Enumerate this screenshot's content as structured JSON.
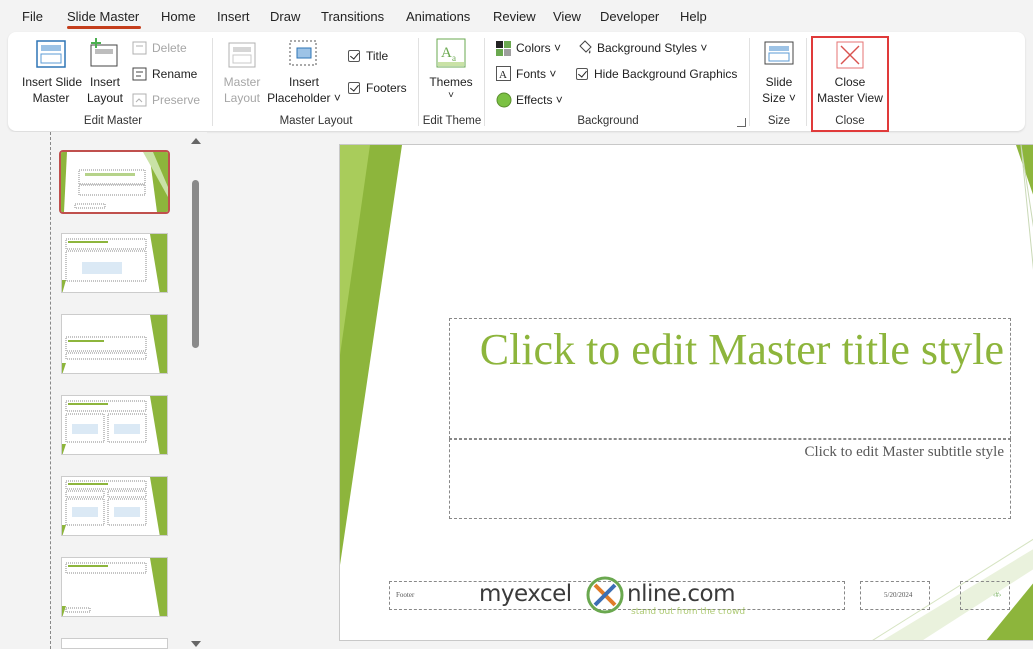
{
  "menu": {
    "tabs": [
      "File",
      "Slide Master",
      "Home",
      "Insert",
      "Draw",
      "Transitions",
      "Animations",
      "Review",
      "View",
      "Developer",
      "Help"
    ],
    "active_tab": "Slide Master"
  },
  "ribbon": {
    "edit_master": {
      "insert_slide_master": [
        "Insert Slide",
        "Master"
      ],
      "insert_layout": [
        "Insert",
        "Layout"
      ],
      "delete": "Delete",
      "rename": "Rename",
      "preserve": "Preserve",
      "group_label": "Edit Master"
    },
    "master_layout": {
      "master_layout": [
        "Master",
        "Layout"
      ],
      "insert_placeholder": [
        "Insert",
        "Placeholder ˅"
      ],
      "title": "Title",
      "footers": "Footers",
      "group_label": "Master Layout"
    },
    "edit_theme": {
      "themes": "Themes",
      "group_label": "Edit Theme"
    },
    "background": {
      "colors": "Colors ˅",
      "fonts": "Fonts ˅",
      "effects": "Effects ˅",
      "background_styles": "Background Styles ˅",
      "hide_background_graphics": "Hide Background Graphics",
      "group_label": "Background"
    },
    "size": {
      "slide_size": [
        "Slide",
        "Size ˅"
      ],
      "group_label": "Size"
    },
    "close": {
      "close_master_view": [
        "Close",
        "Master View"
      ],
      "group_label": "Close"
    }
  },
  "slide": {
    "title": "Click to edit Master title style",
    "subtitle": "Click to edit Master subtitle style",
    "footer": "Footer",
    "date": "5/20/2024",
    "page_number": "‹#›",
    "watermark": {
      "brand_left": "myexcel",
      "brand_right": "nline.com",
      "tagline": "stand out from the crowd"
    }
  },
  "colors": {
    "accent_green": "#8db53c",
    "highlight_red": "#e03a3a",
    "tab_underline": "#c43e1c"
  }
}
